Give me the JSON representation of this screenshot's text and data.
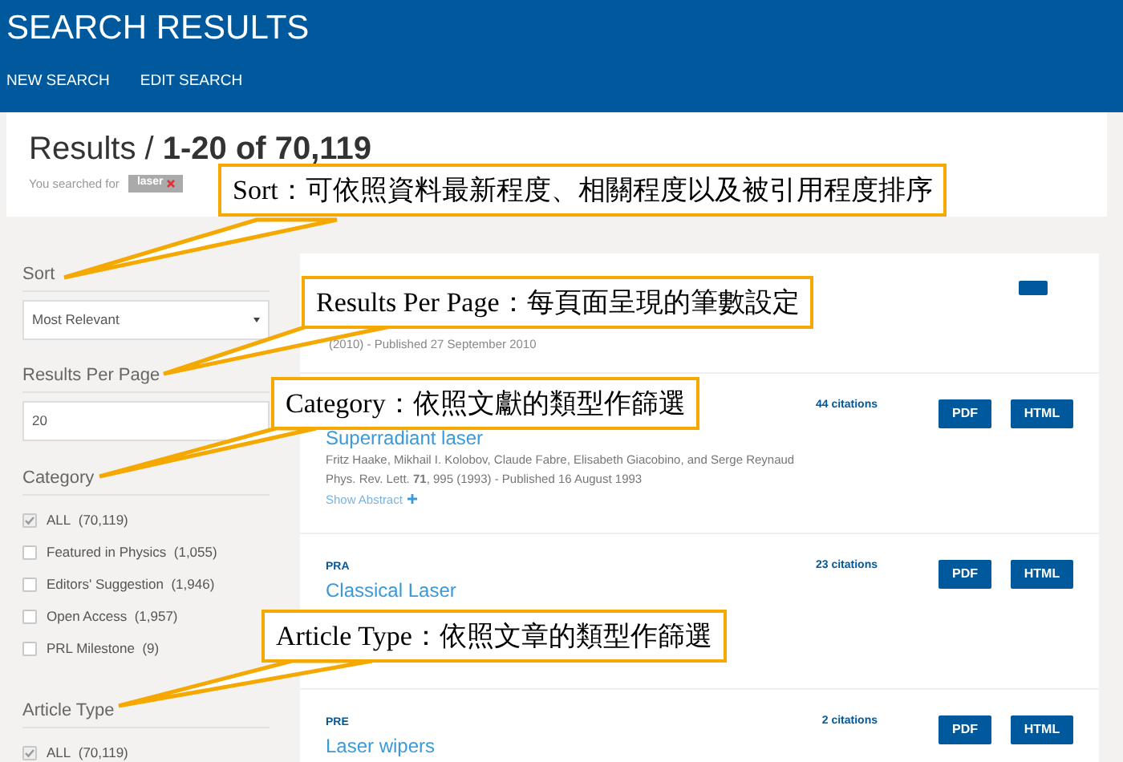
{
  "header": {
    "title": "SEARCH RESULTS",
    "nav": [
      "NEW SEARCH",
      "EDIT SEARCH"
    ]
  },
  "summary": {
    "heading": "Results / **1-20 of 70,119**",
    "searched_for": "You searched for",
    "tag": "laser"
  },
  "sidebar": {
    "sort": {
      "label": "Sort",
      "value": "Most Relevant"
    },
    "results_per_page": {
      "label": "Results Per Page",
      "value": "20"
    },
    "category": {
      "label": "Category",
      "options": [
        {
          "label": "ALL",
          "count": "(70,119)",
          "checked": true
        },
        {
          "label": "Featured in Physics",
          "count": "(1,055)",
          "checked": false
        },
        {
          "label": "Editors' Suggestion",
          "count": "(1,946)",
          "checked": false
        },
        {
          "label": "Open Access",
          "count": "(1,957)",
          "checked": false
        },
        {
          "label": "PRL Milestone",
          "count": "(9)",
          "checked": false
        }
      ]
    },
    "article_type": {
      "label": "Article Type",
      "options": [
        {
          "label": "ALL",
          "count": "(70,119)",
          "checked": true
        }
      ]
    }
  },
  "results": [
    {
      "kind": "partial",
      "citation": "(2010) - Published 27 September 2010"
    },
    {
      "kind": "full",
      "title": "Superradiant laser",
      "citations": "44 citations",
      "authors": "Fritz Haake, Mikhail I. Kolobov, Claude Fabre, Elisabeth Giacobino, and Serge Reynaud",
      "citation": "Phys. Rev. Lett. **71**, 995 (1993) - Published 16 August 1993",
      "show_abstract": "Show Abstract",
      "buttons": [
        "PDF",
        "HTML"
      ]
    },
    {
      "kind": "full",
      "journal": "PRA",
      "title": "Classical Laser",
      "citations": "23 citations",
      "buttons": [
        "PDF",
        "HTML"
      ]
    },
    {
      "kind": "full",
      "journal": "PRE",
      "title": "Laser wipers",
      "citations": "2 citations",
      "buttons": [
        "PDF",
        "HTML"
      ]
    }
  ],
  "callouts": [
    "Sort：可依照資料最新程度、相關程度以及被引用程度排序",
    "Results Per Page：每頁面呈現的筆數設定",
    "Category：依照文獻的類型作篩選",
    "Article Type：依照文章的類型作篩選"
  ]
}
